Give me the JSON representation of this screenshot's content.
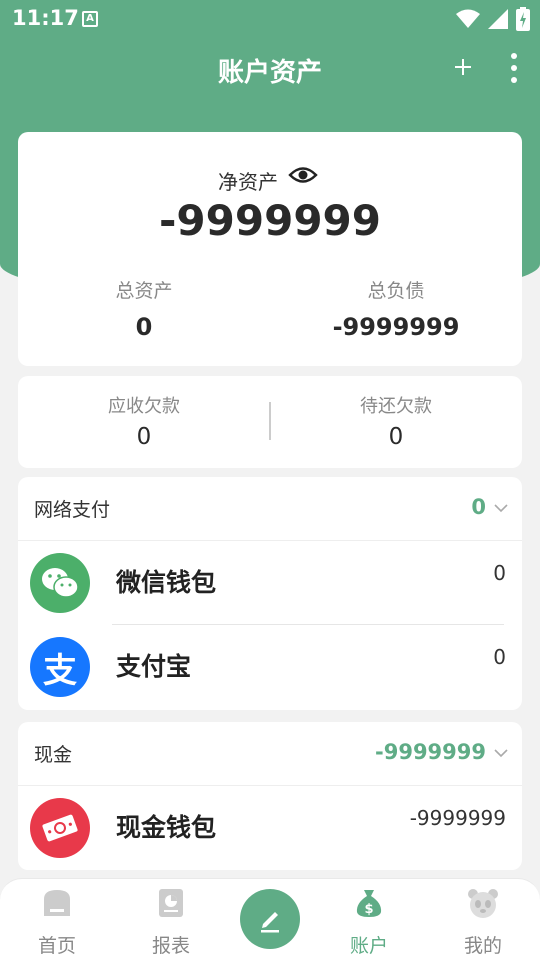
{
  "status_bar": {
    "time": "11:17",
    "a_badge": "A"
  },
  "app_bar": {
    "title": "账户资产"
  },
  "net_worth": {
    "label": "净资产",
    "value": "-9999999",
    "total_assets_label": "总资产",
    "total_assets_value": "0",
    "total_liabilities_label": "总负债",
    "total_liabilities_value": "-9999999"
  },
  "debts": {
    "receivable_label": "应收欠款",
    "receivable_value": "0",
    "payable_label": "待还欠款",
    "payable_value": "0"
  },
  "groups": [
    {
      "name": "网络支付",
      "total": "0",
      "accounts": [
        {
          "name": "微信钱包",
          "value": "0",
          "icon": "wechat-icon",
          "color": "#4caf6a"
        },
        {
          "name": "支付宝",
          "value": "0",
          "icon": "alipay-icon",
          "color": "#1677ff"
        }
      ]
    },
    {
      "name": "现金",
      "total": "-9999999",
      "accounts": [
        {
          "name": "现金钱包",
          "value": "-9999999",
          "icon": "cash-icon",
          "color": "#e8394a"
        }
      ]
    }
  ],
  "tabs": [
    {
      "label": "首页",
      "icon": "home-icon"
    },
    {
      "label": "报表",
      "icon": "report-icon"
    },
    {
      "label": "",
      "icon": "edit-icon"
    },
    {
      "label": "账户",
      "icon": "money-bag-icon"
    },
    {
      "label": "我的",
      "icon": "panda-icon"
    }
  ],
  "colors": {
    "primary": "#5fac86",
    "active_tab": "#5fac86"
  }
}
